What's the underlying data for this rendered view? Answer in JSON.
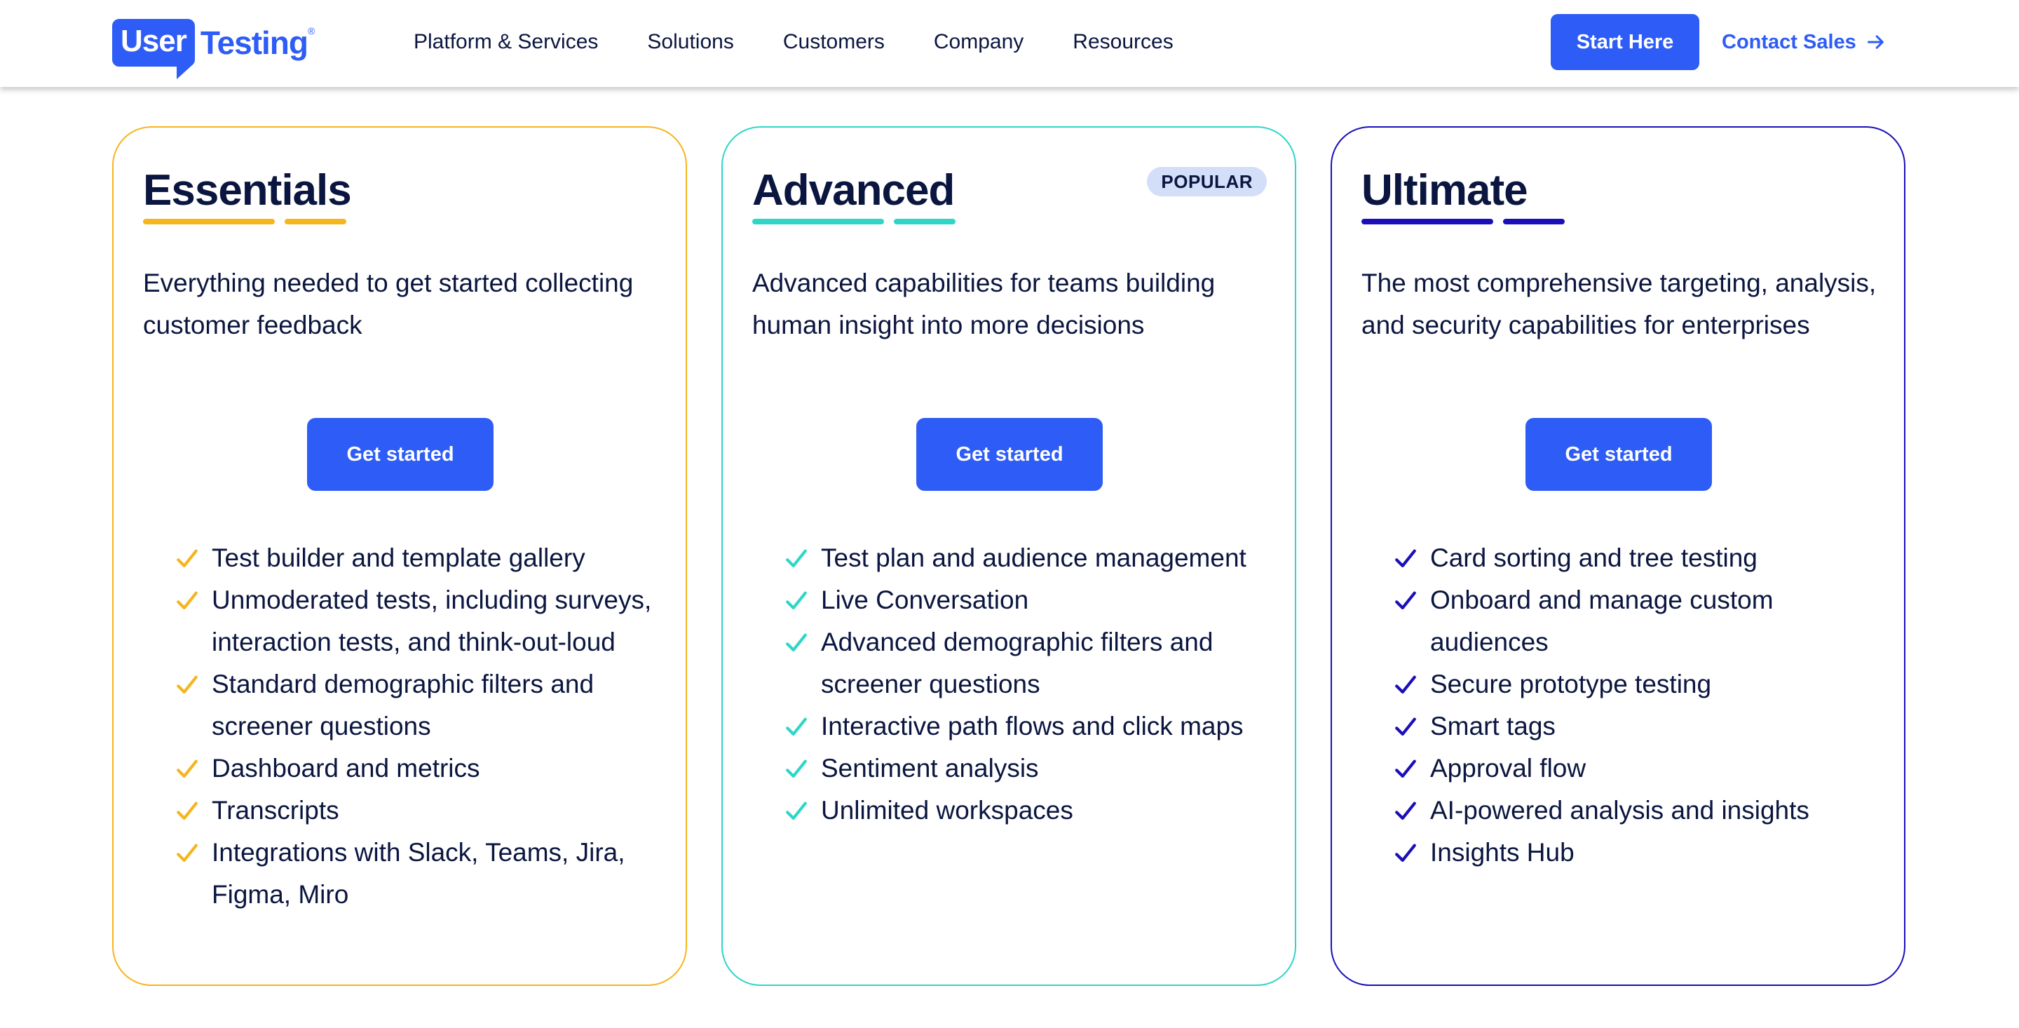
{
  "brand": {
    "logo_part1": "User",
    "logo_part2": "Testing",
    "logo_mark": "®",
    "color": "#2e5cf6"
  },
  "nav": {
    "items": [
      "Platform & Services",
      "Solutions",
      "Customers",
      "Company",
      "Resources"
    ],
    "start_label": "Start Here",
    "contact_label": "Contact Sales",
    "contact_icon": "arrow-right-icon"
  },
  "plans": [
    {
      "id": "essentials",
      "title": "Essentials",
      "accent": "#f5b51f",
      "badge": "",
      "description": "Everything needed to get started collecting customer feedback",
      "cta": "Get started",
      "features": [
        "Test builder and template gallery",
        "Unmoderated tests, including surveys, interaction tests, and think-out-loud",
        "Standard demographic filters and screener questions",
        "Dashboard and metrics",
        "Transcripts",
        "Integrations with Slack, Teams, Jira, Figma, Miro"
      ]
    },
    {
      "id": "advanced",
      "title": "Advanced",
      "accent": "#2fd6c8",
      "badge": "POPULAR",
      "description": "Advanced capabilities for teams building human insight into more decisions",
      "cta": "Get started",
      "features": [
        "Test plan and audience management",
        "Live Conversation",
        "Advanced demographic filters and screener questions",
        "Interactive path flows and click maps",
        "Sentiment analysis",
        "Unlimited workspaces"
      ]
    },
    {
      "id": "ultimate",
      "title": "Ultimate",
      "accent": "#1a0fb8",
      "badge": "",
      "description": "The most comprehensive targeting, analysis, and security capabilities for enterprises",
      "cta": "Get started",
      "features": [
        "Card sorting and tree testing",
        "Onboard and manage custom audiences",
        "Secure prototype testing",
        "Smart tags",
        "Approval flow",
        "AI-powered analysis and insights",
        "Insights Hub"
      ]
    }
  ]
}
